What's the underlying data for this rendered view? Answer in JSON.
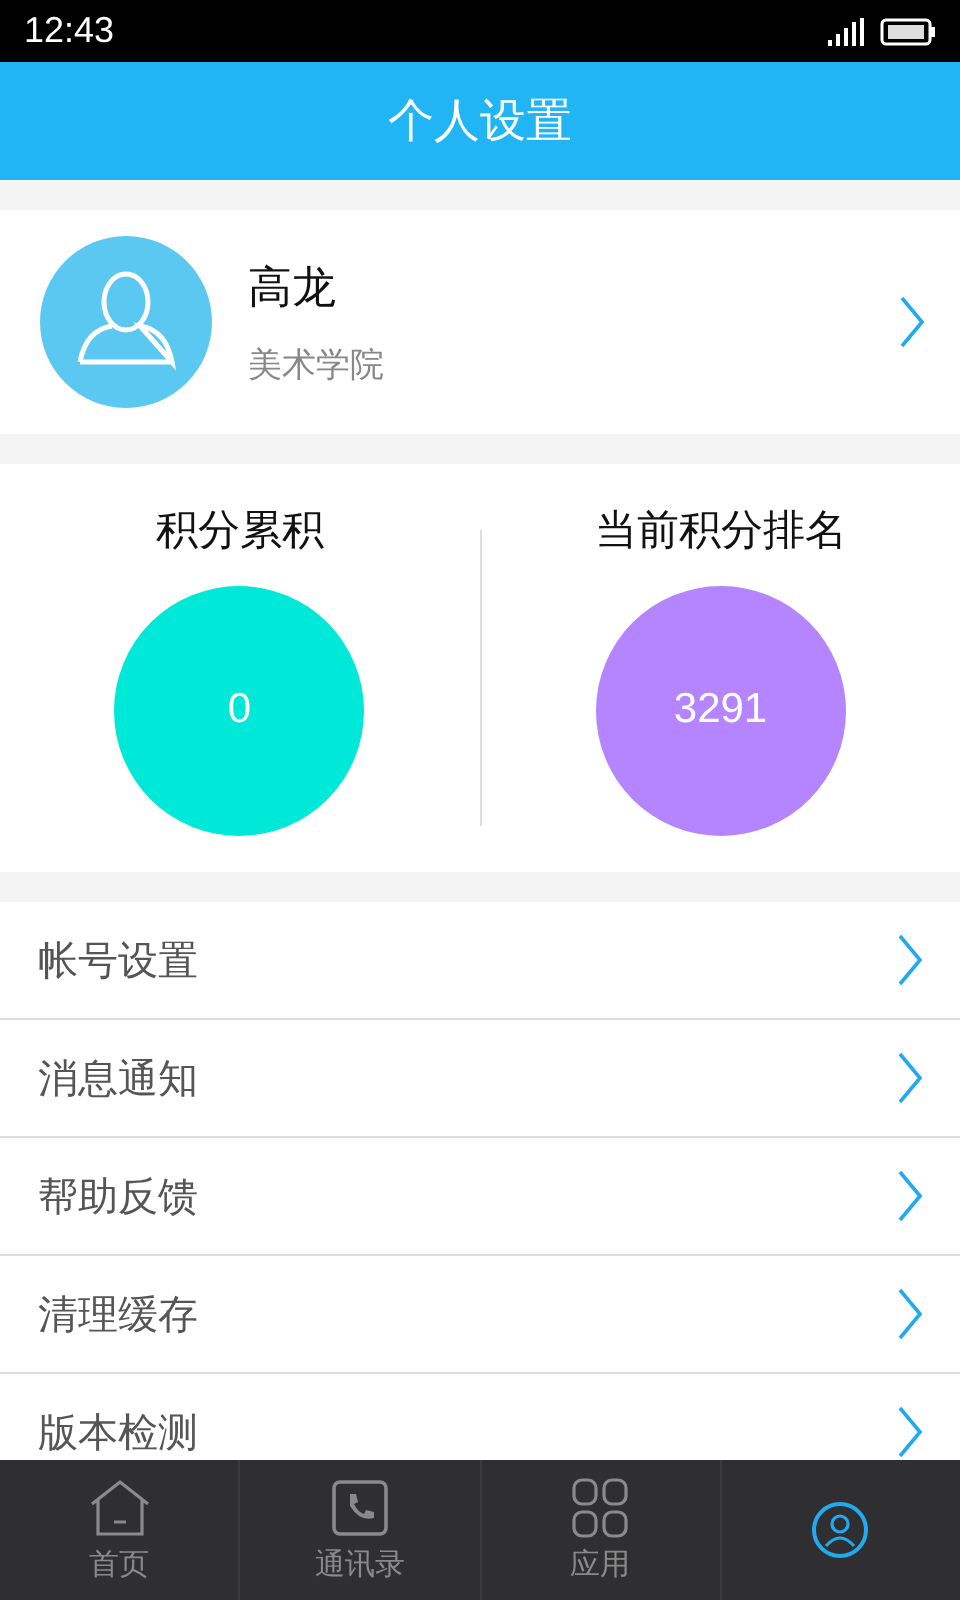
{
  "status_bar": {
    "time": "12:43"
  },
  "header": {
    "title": "个人设置"
  },
  "profile": {
    "name": "高龙",
    "subtitle": "美术学院"
  },
  "stats": [
    {
      "label": "积分累积",
      "value": "0",
      "color": "#00e8d8"
    },
    {
      "label": "当前积分排名",
      "value": "3291",
      "color": "#b585ff"
    }
  ],
  "menu": [
    {
      "label": "帐号设置"
    },
    {
      "label": "消息通知"
    },
    {
      "label": "帮助反馈"
    },
    {
      "label": "清理缓存"
    },
    {
      "label": "版本检测"
    }
  ],
  "tabs": [
    {
      "kind": "home",
      "label": "首页",
      "selected": false
    },
    {
      "kind": "contacts",
      "label": "通讯录",
      "selected": false
    },
    {
      "kind": "apps",
      "label": "应用",
      "selected": false
    },
    {
      "kind": "me",
      "selected": true
    }
  ]
}
